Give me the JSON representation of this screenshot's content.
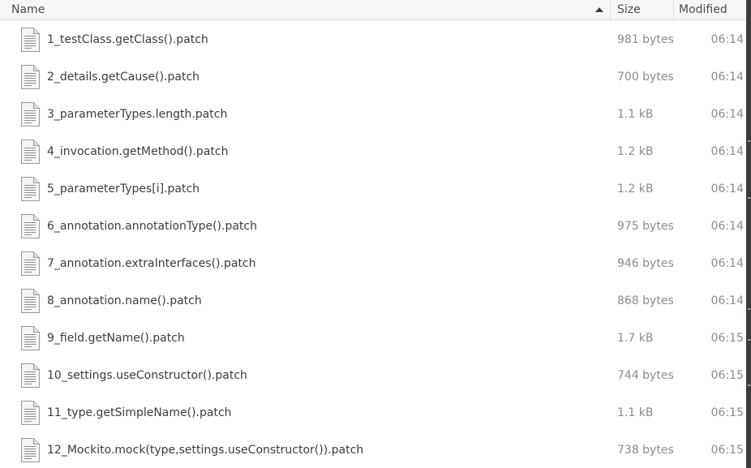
{
  "columns": {
    "name": "Name",
    "size": "Size",
    "modified": "Modified"
  },
  "sort": {
    "column": "name",
    "direction": "ascending",
    "icon": "sort-ascending-icon"
  },
  "files": [
    {
      "name": "1_testClass.getClass().patch",
      "size": "981 bytes",
      "modified": "06:14",
      "icon": "text-file-icon"
    },
    {
      "name": "2_details.getCause().patch",
      "size": "700 bytes",
      "modified": "06:14",
      "icon": "text-file-icon"
    },
    {
      "name": "3_parameterTypes.length.patch",
      "size": "1.1 kB",
      "modified": "06:14",
      "icon": "text-file-icon"
    },
    {
      "name": "4_invocation.getMethod().patch",
      "size": "1.2 kB",
      "modified": "06:14",
      "icon": "text-file-icon"
    },
    {
      "name": "5_parameterTypes[i].patch",
      "size": "1.2 kB",
      "modified": "06:14",
      "icon": "text-file-icon"
    },
    {
      "name": "6_annotation.annotationType().patch",
      "size": "975 bytes",
      "modified": "06:14",
      "icon": "text-file-icon"
    },
    {
      "name": "7_annotation.extraInterfaces().patch",
      "size": "946 bytes",
      "modified": "06:14",
      "icon": "text-file-icon"
    },
    {
      "name": "8_annotation.name().patch",
      "size": "868 bytes",
      "modified": "06:14",
      "icon": "text-file-icon"
    },
    {
      "name": "9_field.getName().patch",
      "size": "1.7 kB",
      "modified": "06:15",
      "icon": "text-file-icon"
    },
    {
      "name": "10_settings.useConstructor().patch",
      "size": "744 bytes",
      "modified": "06:15",
      "icon": "text-file-icon"
    },
    {
      "name": "11_type.getSimpleName().patch",
      "size": "1.1 kB",
      "modified": "06:15",
      "icon": "text-file-icon"
    },
    {
      "name": "12_Mockito.mock(type,settings.useConstructor()).patch",
      "size": "738 bytes",
      "modified": "06:15",
      "icon": "text-file-icon"
    }
  ],
  "colors": {
    "header_bg": "#f6f6f5",
    "text": "#3c3c3c",
    "secondary_text": "#8c8c8c",
    "edge_accent": "#e8912d"
  }
}
